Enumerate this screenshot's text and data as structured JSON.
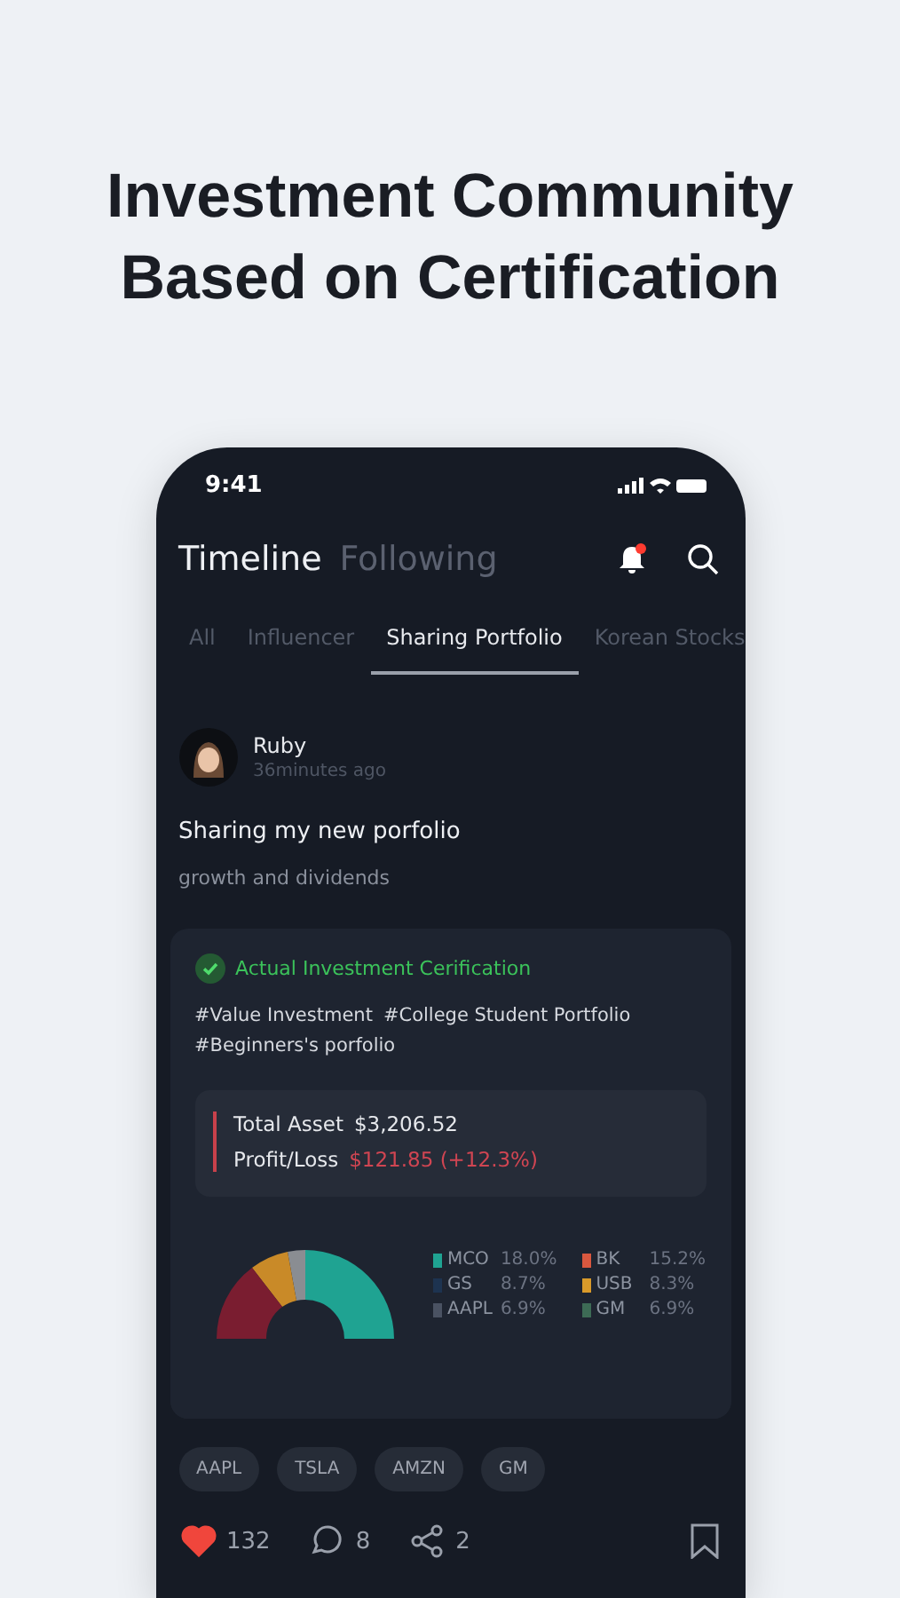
{
  "headline": [
    "Investment Community",
    "Based on Certification"
  ],
  "status_bar": {
    "time": "9:41"
  },
  "header_tabs": [
    {
      "label": "Timeline",
      "selected": true
    },
    {
      "label": "Following",
      "selected": false
    }
  ],
  "notifications": {
    "unread": true
  },
  "category_tabs": [
    {
      "label": "All",
      "selected": false
    },
    {
      "label": "Influencer",
      "selected": false
    },
    {
      "label": "Sharing Portfolio",
      "selected": true
    },
    {
      "label": "Korean Stocks",
      "selected": false
    }
  ],
  "post": {
    "author": "Ruby",
    "time": "36minutes ago",
    "title": "Sharing my new porfolio",
    "body": "growth and dividends",
    "certification": {
      "label": "Actual Investment Cerification",
      "verified": true
    },
    "hashtags": [
      "#Value Investment",
      "#College Student Portfolio",
      "#Beginners's porfolio"
    ],
    "summary": [
      {
        "label": "Total Asset",
        "value": "$3,206.52",
        "kind": "neutral"
      },
      {
        "label": "Profit/Loss",
        "value": "$121.85 (+12.3%)",
        "kind": "gain"
      }
    ],
    "legend": [
      {
        "ticker": "MCO",
        "share": "18.0%",
        "color": "#1fa392"
      },
      {
        "ticker": "BK",
        "share": "15.2%",
        "color": "#d9583f"
      },
      {
        "ticker": "GS",
        "share": "8.7%",
        "color": "#1d3350"
      },
      {
        "ticker": "USB",
        "share": "8.3%",
        "color": "#d99a2a"
      },
      {
        "ticker": "AAPL",
        "share": "6.9%",
        "color": "#4a5262"
      },
      {
        "ticker": "GM",
        "share": "6.9%",
        "color": "#3d6b55"
      }
    ],
    "tickers": [
      "AAPL",
      "TSLA",
      "AMZN",
      "GM"
    ],
    "likes": {
      "count": "132",
      "liked": true
    },
    "comments": "8",
    "shares": "2",
    "bookmarked": false
  }
}
